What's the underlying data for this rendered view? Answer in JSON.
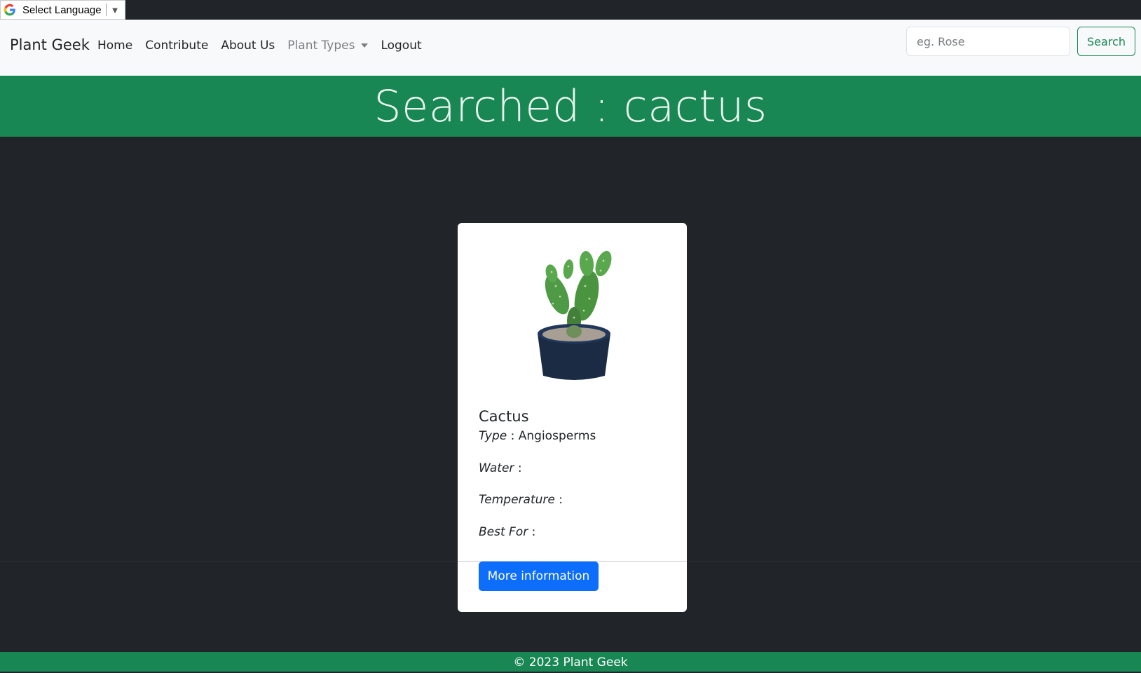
{
  "translate": {
    "label": "Select Language",
    "arrow": "▼",
    "icon": "google-g-icon"
  },
  "navbar": {
    "brand": "Plant Geek",
    "links": [
      "Home",
      "Contribute",
      "About Us",
      "Plant Types",
      "Logout"
    ],
    "search_placeholder": "eg. Rose",
    "search_button": "Search"
  },
  "banner": {
    "title": "Searched : cactus"
  },
  "card": {
    "title": "Cactus",
    "image_icon": "potted-cactus-image",
    "attributes": [
      {
        "label": "Type",
        "value": "Angiosperms"
      },
      {
        "label": "Water",
        "value": ""
      },
      {
        "label": "Temperature",
        "value": ""
      },
      {
        "label": "Best For",
        "value": ""
      }
    ],
    "button": "More information"
  },
  "footer": {
    "text": "© 2023 Plant Geek"
  },
  "colors": {
    "primary_green": "#198754",
    "dark_bg": "#212529",
    "navbar_bg": "#f8f9fa",
    "button_blue": "#0d6efd"
  }
}
